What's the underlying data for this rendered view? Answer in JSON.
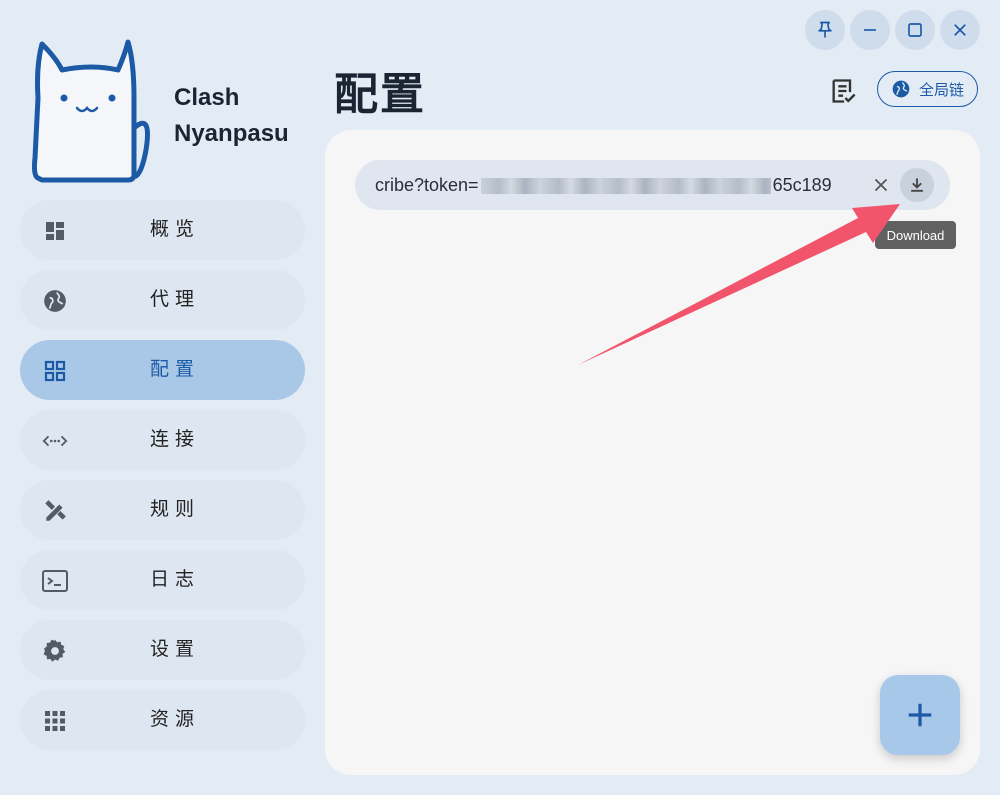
{
  "app": {
    "name_line1": "Clash",
    "name_line2": "Nyanpasu"
  },
  "window_controls": [
    "pin-icon",
    "minimize-icon",
    "maximize-icon",
    "close-icon"
  ],
  "nav": {
    "items": [
      {
        "label": "概览",
        "icon": "dashboard-icon",
        "active": false
      },
      {
        "label": "代理",
        "icon": "globe-icon",
        "active": false
      },
      {
        "label": "配置",
        "icon": "grid-icon",
        "active": true
      },
      {
        "label": "连接",
        "icon": "connection-icon",
        "active": false
      },
      {
        "label": "规则",
        "icon": "rules-icon",
        "active": false
      },
      {
        "label": "日志",
        "icon": "terminal-icon",
        "active": false
      },
      {
        "label": "设置",
        "icon": "gear-icon",
        "active": false
      },
      {
        "label": "资源",
        "icon": "apps-grid-icon",
        "active": false
      }
    ]
  },
  "header": {
    "title": "配置",
    "global_label": "全局链"
  },
  "url_field": {
    "prefix": "cribe?token=",
    "suffix": "65c189"
  },
  "tooltip": {
    "text": "Download"
  },
  "colors": {
    "accent": "#1c5aa6",
    "active_nav": "#a9c8e8",
    "arrow": "#f2556b"
  }
}
